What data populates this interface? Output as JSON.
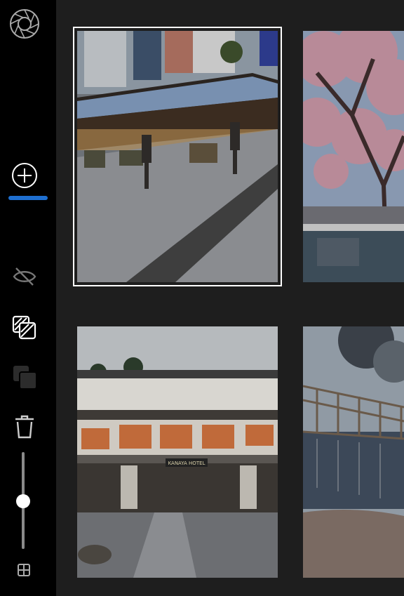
{
  "app": {
    "colors": {
      "sidebar_bg": "#000000",
      "main_bg": "#1e1e1e",
      "accent": "#1e6fd0",
      "selection_outline": "#ffffff"
    }
  },
  "sidebar": {
    "items": [
      {
        "name": "aperture-logo-icon",
        "icon": "aperture",
        "interactable": true
      },
      {
        "name": "add-button",
        "icon": "plus-circle",
        "interactable": true,
        "active": true
      },
      {
        "name": "hide-button",
        "icon": "eye-off",
        "interactable": true
      },
      {
        "name": "duplicate-button",
        "icon": "stacked-squares-striped",
        "interactable": true
      },
      {
        "name": "stack-button",
        "icon": "stacked-squares",
        "interactable": true,
        "disabled": true
      },
      {
        "name": "delete-button",
        "icon": "trash",
        "interactable": true
      },
      {
        "name": "grid-view-button",
        "icon": "grid",
        "interactable": true
      }
    ],
    "zoom_slider": {
      "value": 0.5
    }
  },
  "gallery": {
    "photos": [
      {
        "name": "photo-street-market",
        "subject": "street-market",
        "selected": true
      },
      {
        "name": "photo-cherry-blossom",
        "subject": "cherry-blossom",
        "selected": false
      },
      {
        "name": "photo-kanaya-hotel",
        "subject": "hotel",
        "selected": false,
        "sign_text": "KANAYA HOTEL"
      },
      {
        "name": "photo-pier",
        "subject": "pier",
        "selected": false
      }
    ]
  }
}
